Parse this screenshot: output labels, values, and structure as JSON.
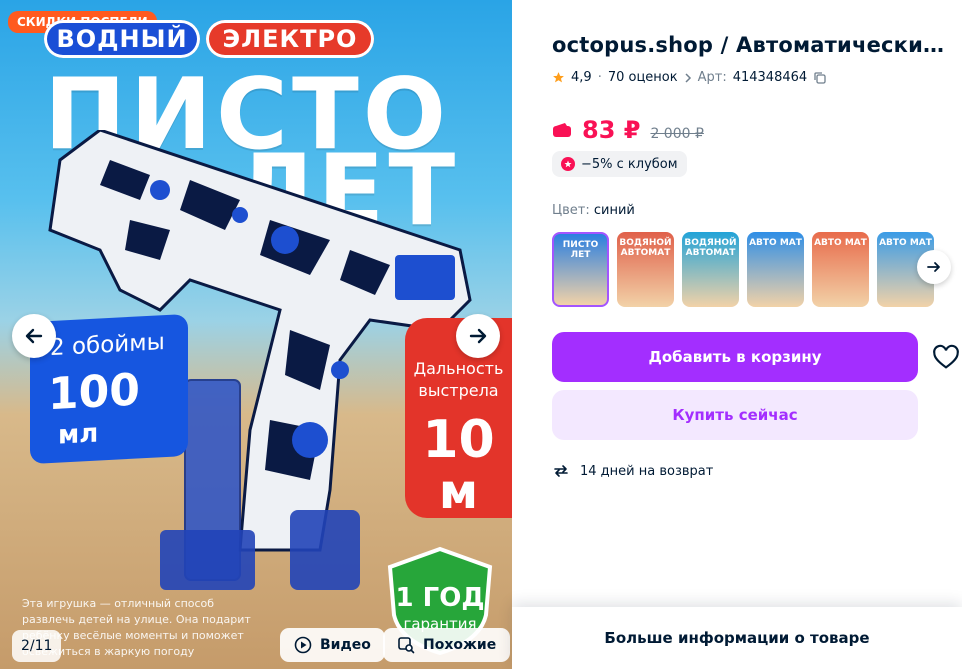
{
  "gallery": {
    "sale_badge": "СКИДКИ ПОСПЕЛИ",
    "pill_left": "ВОДНЫЙ",
    "pill_right": "ЭЛЕКТРО",
    "headline_1": "ПИСТО",
    "headline_2": "ЛЕТ",
    "magazines": "2 обоймы",
    "volume_value": "100",
    "volume_unit": "мл",
    "range_label": "Дальность выстрела",
    "range_value": "10",
    "range_unit": "м",
    "warranty_title": "1 ГОД",
    "warranty_sub": "гарантия",
    "description": "Эта игрушка — отличный способ развлечь детей на улице. Она подарит ребёнку весёлые моменты и поможет освежиться в жаркую погоду",
    "counter": "2/11",
    "video_label": "Видео",
    "similar_label": "Похожие"
  },
  "product": {
    "title": "octopus.shop / Автоматический водный пистолет электрический",
    "rating": "4,9",
    "reviews": "70 оценок",
    "article_label": "Арт:",
    "article": "414348464",
    "price": "83 ₽",
    "old_price": "2 000 ₽",
    "club_discount": "−5% с клубом",
    "color_label": "Цвет:",
    "color_value": "синий",
    "thumbnails": [
      {
        "label": "ПИСТО ЛЕТ",
        "color": "#2b7fe0"
      },
      {
        "label": "ВОДЯНОЙ АВТОМАТ",
        "color": "#e0604a"
      },
      {
        "label": "ВОДЯНОЙ АВТОМАТ",
        "color": "#22a3d8"
      },
      {
        "label": "АВТО МАТ",
        "color": "#2f8ee6"
      },
      {
        "label": "АВТО МАТ",
        "color": "#e86b4b"
      },
      {
        "label": "АВТО МАТ",
        "color": "#3a9be6"
      }
    ],
    "add_to_cart": "Добавить в корзину",
    "buy_now": "Купить сейчас",
    "return_policy": "14 дней на возврат",
    "more_info": "Больше информации о товаре"
  },
  "colors": {
    "accent": "#a32eff",
    "price": "#f91155",
    "star": "#ff9e1b"
  }
}
